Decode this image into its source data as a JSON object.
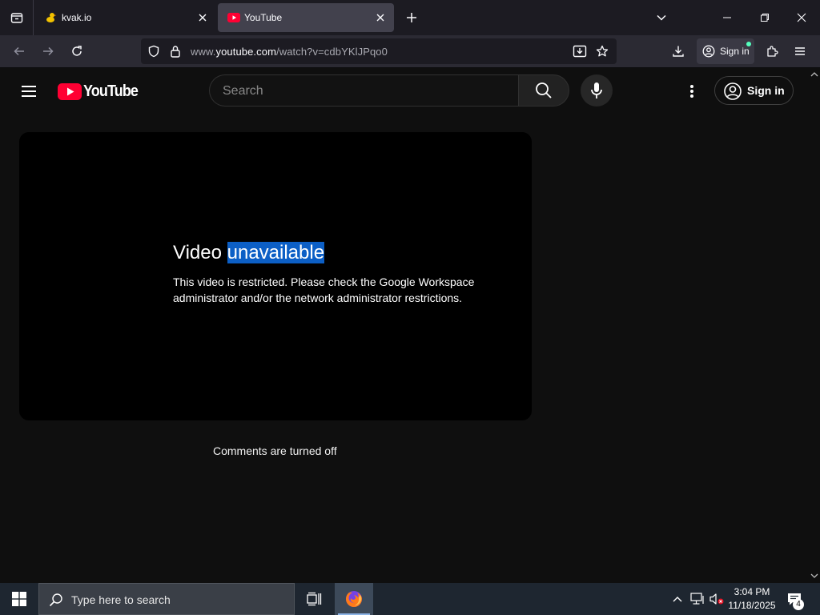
{
  "browser": {
    "tabs": [
      {
        "title": "kvak.io",
        "active": false,
        "favicon": "duck-favicon"
      },
      {
        "title": "YouTube",
        "active": true,
        "favicon": "youtube-favicon"
      }
    ],
    "url": {
      "prefix": "www.",
      "host": "youtube.com",
      "path": "/watch?v=cdbYKlJPqo0"
    },
    "account_label": "Sign in"
  },
  "youtube": {
    "logo_text": "YouTube",
    "search_placeholder": "Search",
    "signin_label": "Sign in",
    "error": {
      "title_prefix": "Video ",
      "title_highlight": "unavailable",
      "message": "This video is restricted. Please check the Google Workspace administrator and/or the network administrator restrictions."
    },
    "comments_status": "Comments are turned off"
  },
  "taskbar": {
    "search_placeholder": "Type here to search",
    "time": "3:04 PM",
    "date": "11/18/2025",
    "notification_count": "4"
  },
  "colors": {
    "brand_red": "#ff0033",
    "selection": "#0c5fc6",
    "background": "#0f0f0f"
  }
}
